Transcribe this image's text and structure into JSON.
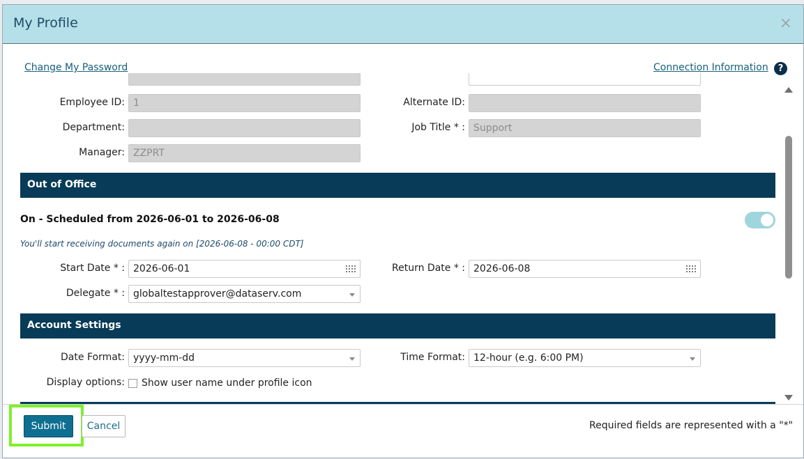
{
  "modal": {
    "title": "My Profile",
    "close_label": "×"
  },
  "links": {
    "change_password": "Change My Password",
    "connection_info": "Connection Information",
    "help": "?"
  },
  "profile": {
    "employee_id": {
      "label": "Employee ID:",
      "value": "1"
    },
    "alternate_id": {
      "label": "Alternate ID:",
      "value": ""
    },
    "department": {
      "label": "Department:",
      "value": ""
    },
    "job_title": {
      "label": "Job Title * :",
      "value": "Support"
    },
    "manager": {
      "label": "Manager:",
      "value": "ZZPRT"
    }
  },
  "out_of_office": {
    "header": "Out of Office",
    "status": "On - Scheduled from 2026-06-01 to 2026-06-08",
    "note": "You'll start receiving documents again on [2026-06-08 - 00:00 CDT]",
    "toggle_on": true,
    "start_date": {
      "label": "Start Date * :",
      "value": "2026-06-01"
    },
    "return_date": {
      "label": "Return Date * :",
      "value": "2026-06-08"
    },
    "delegate": {
      "label": "Delegate * :",
      "value": "globaltestapprover@dataserv.com"
    }
  },
  "account_settings": {
    "header": "Account Settings",
    "date_format": {
      "label": "Date Format:",
      "value": "yyyy-mm-dd"
    },
    "time_format": {
      "label": "Time Format:",
      "value": "12-hour (e.g. 6:00 PM)"
    },
    "display_options": {
      "label": "Display options:",
      "checkbox_label": "Show user name under profile icon",
      "checked": false
    }
  },
  "footer": {
    "submit": "Submit",
    "cancel": "Cancel",
    "required_note": "Required fields are represented with a \"*\""
  },
  "colors": {
    "header_bg": "#b6e0e9",
    "section_bg": "#073b57",
    "primary_button": "#0e6f91",
    "highlight": "#7df22a"
  }
}
